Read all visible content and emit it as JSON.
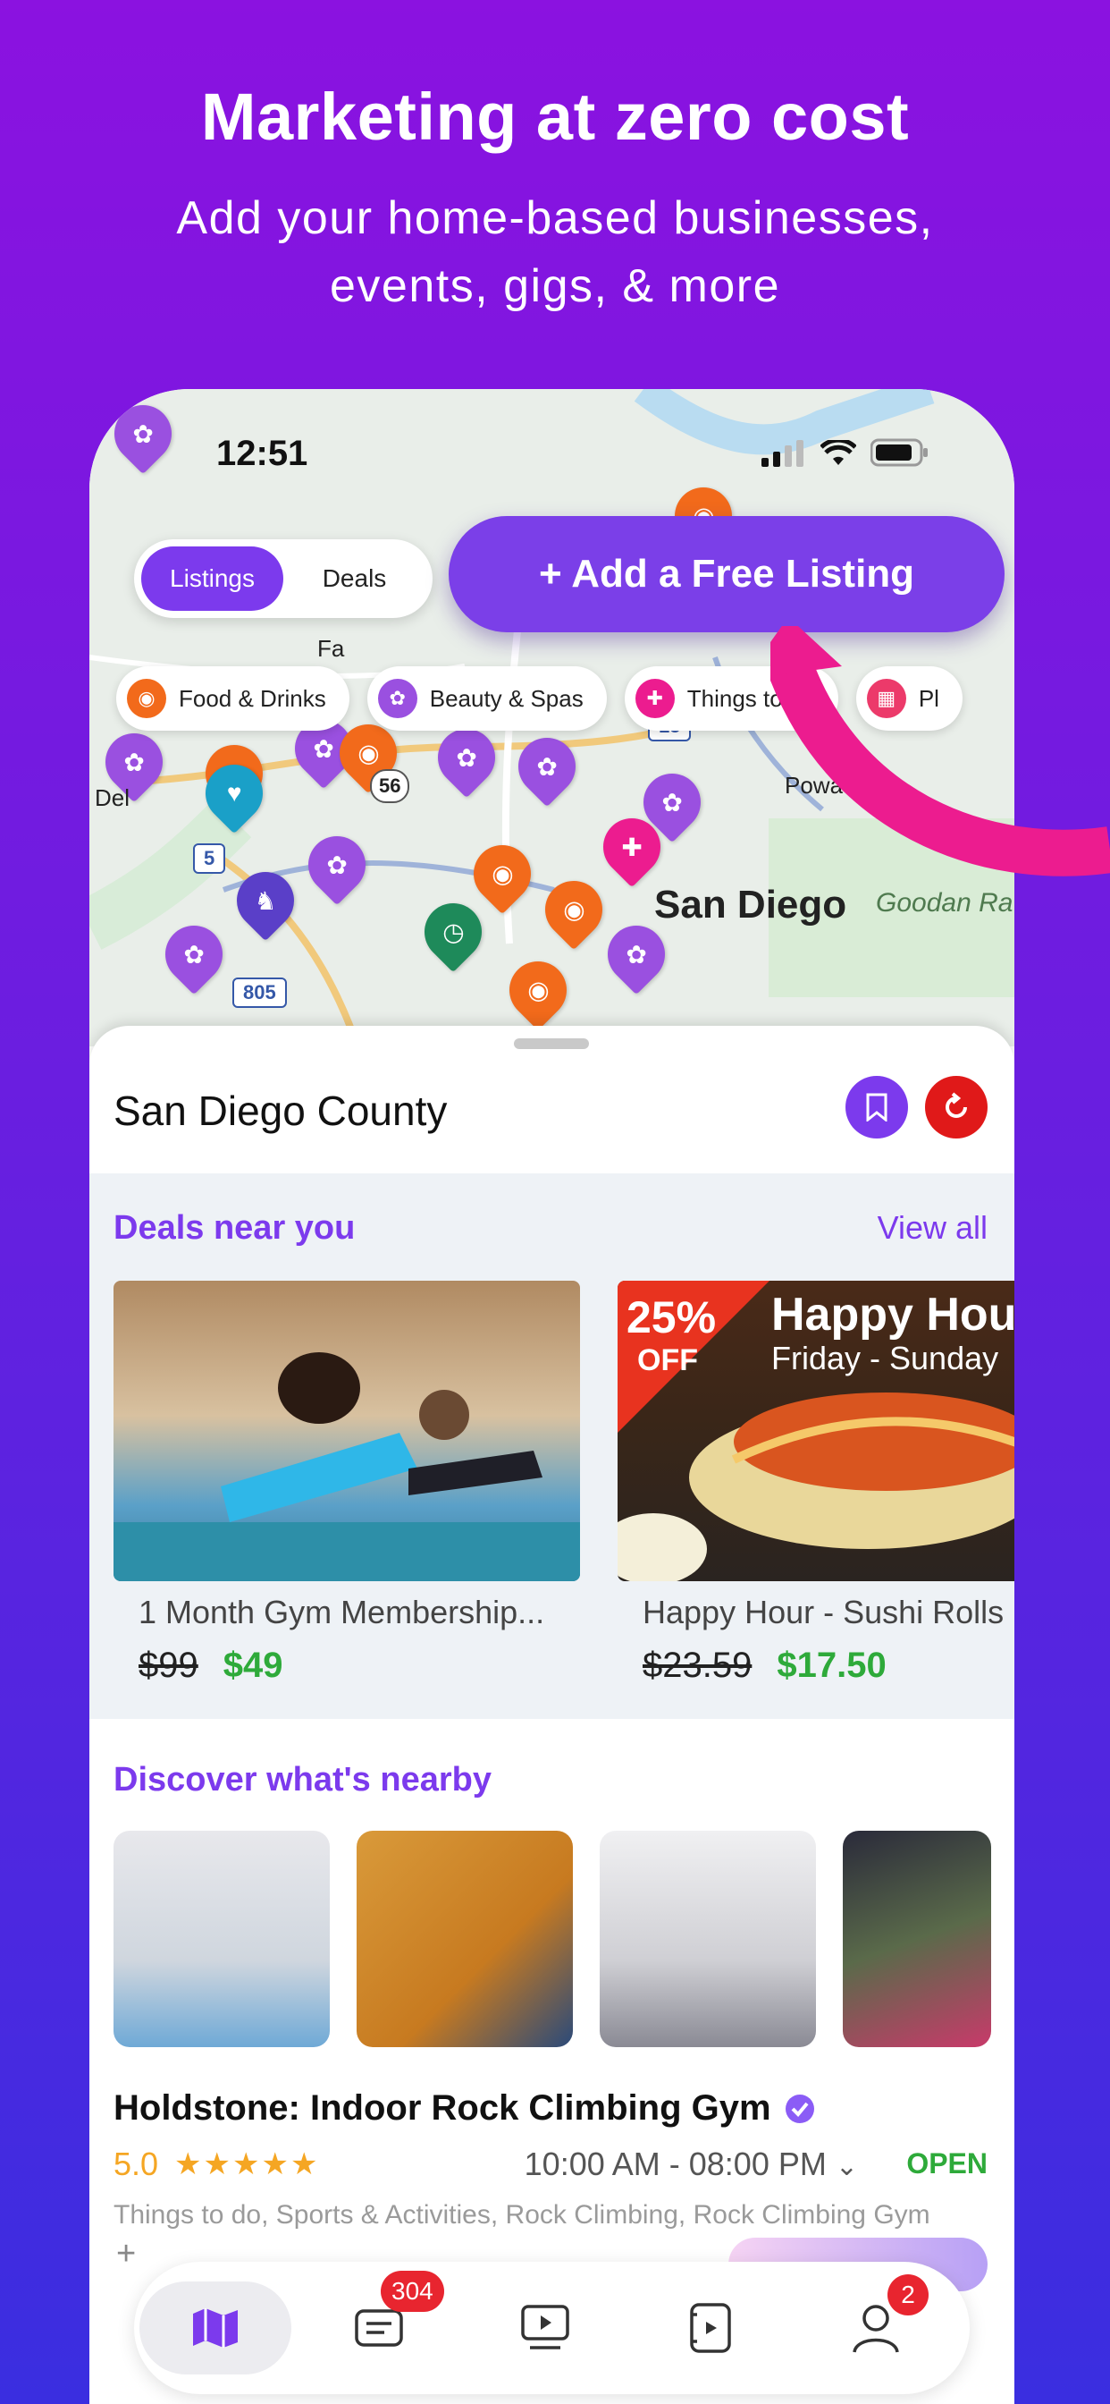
{
  "promo": {
    "headline": "Marketing at zero cost",
    "subline": "Add your home-based businesses, events, gigs, & more"
  },
  "status_bar": {
    "time": "12:51"
  },
  "map": {
    "segment": {
      "listings": "Listings",
      "deals": "Deals"
    },
    "cta_label": "+ Add a Free Listing",
    "chips": [
      "Food & Drinks",
      "Beauty & Spas",
      "Things to do",
      "Pl"
    ],
    "labels": {
      "city": "San Diego",
      "goodan": "Goodan Ra",
      "poway": "Powa",
      "del": "Del",
      "fairbanks": "Fa",
      "road_56": "56",
      "road_5": "5",
      "road_805": "805",
      "road_15": "15"
    }
  },
  "sheet": {
    "county": "San Diego County",
    "deals_title": "Deals near you",
    "view_all": "View all",
    "deals": [
      {
        "name": "1 Month Gym Membership...",
        "old_price": "$99",
        "new_price": "$49"
      },
      {
        "name": "Happy Hour - Sushi Rolls",
        "old_price": "$23.59",
        "new_price": "$17.50",
        "badge_pct": "25%",
        "badge_off": "OFF",
        "overlay_title": "Happy Hou",
        "overlay_sub": "Friday - Sunday"
      }
    ],
    "discover_title": "Discover what's nearby",
    "business": {
      "name": "Holdstone: Indoor Rock Climbing Gym",
      "rating": "5.0",
      "stars": "★★★★★",
      "hours": "10:00 AM - 08:00 PM",
      "status": "OPEN",
      "categories": "Things to do, Sports & Activities, Rock Climbing, Rock Climbing Gym"
    }
  },
  "tabbar": {
    "messages_badge": "304",
    "profile_badge": "2",
    "plus": "+"
  },
  "colors": {
    "accent": "#7c3aed",
    "pink": "#ec1c8f",
    "orange": "#f26a1b",
    "green": "#2eaa3a",
    "red": "#e8252f"
  }
}
